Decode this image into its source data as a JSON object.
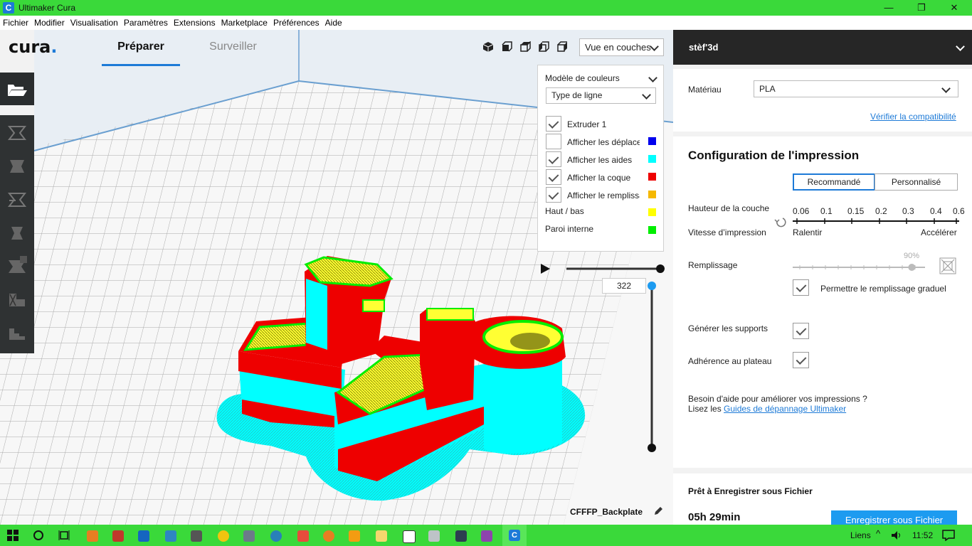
{
  "window": {
    "title": "Ultimaker Cura",
    "app_icon_letter": "C"
  },
  "menu": [
    "Fichier",
    "Modifier",
    "Visualisation",
    "Paramètres",
    "Extensions",
    "Marketplace",
    "Préférences",
    "Aide"
  ],
  "header": {
    "logo": "cura",
    "tabs": [
      {
        "label": "Préparer",
        "active": true
      },
      {
        "label": "Surveiller",
        "active": false
      }
    ],
    "view_mode": "Vue en couches"
  },
  "color_panel": {
    "scheme_label": "Modèle de couleurs",
    "scheme_value": "Type de ligne",
    "items": [
      {
        "label": "Extruder 1",
        "checked": true,
        "color": null
      },
      {
        "label": "Afficher les déplacements",
        "checked": false,
        "color": "#0000ee"
      },
      {
        "label": "Afficher les aides",
        "checked": true,
        "color": "#00ffff"
      },
      {
        "label": "Afficher la coque",
        "checked": true,
        "color": "#ee0000"
      },
      {
        "label": "Afficher le remplissage",
        "checked": true,
        "color": "#f5b800"
      }
    ],
    "legend": [
      {
        "label": "Haut / bas",
        "color": "#ffff00"
      },
      {
        "label": "Paroi interne",
        "color": "#00ee00"
      }
    ]
  },
  "layer_slider": {
    "current_layer": "322"
  },
  "object_name": "CFFFP_Backplate",
  "right_panel": {
    "printer": "stèf'3d",
    "material_label": "Matériau",
    "material_value": "PLA",
    "compat_link": "Vérifier la compatibilité",
    "config_title": "Configuration de l'impression",
    "mode_tabs": [
      "Recommandé",
      "Personnalisé"
    ],
    "layer_height_label": "Hauteur de la couche",
    "layer_heights": [
      "0.06",
      "0.1",
      "0.15",
      "0.2",
      "0.3",
      "0.4",
      "0.6"
    ],
    "speed_label": "Vitesse d’impression",
    "speed_slow": "Ralentir",
    "speed_fast": "Accélérer",
    "infill_label": "Remplissage",
    "infill_value": "90%",
    "infill_fraction": 0.9,
    "gradual_label": "Permettre le remplissage graduel",
    "supports_label": "Générer les supports",
    "adhesion_label": "Adhérence au plateau",
    "help_text": "Besoin d'aide pour améliorer vos impressions ?",
    "help_prefix": "Lisez les ",
    "help_link": "Guides de dépannage Ultimaker",
    "ready_label": "Prêt à Enregistrer sous Fichier",
    "time": "05h 29min",
    "save_button": "Enregistrer sous Fichier"
  },
  "taskbar": {
    "links": "Liens",
    "time": "11:52"
  }
}
